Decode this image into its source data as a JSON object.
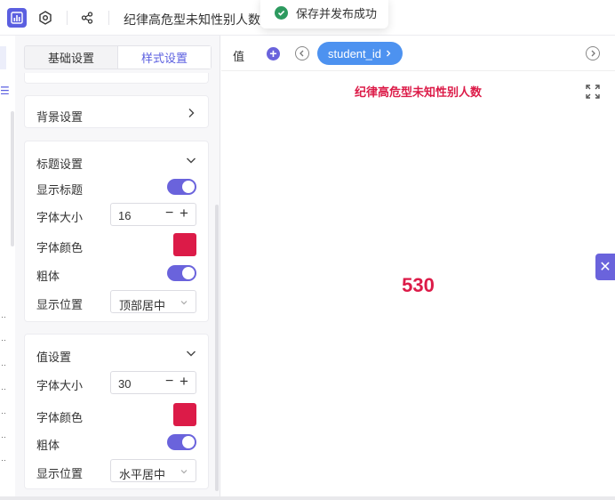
{
  "toolbar": {
    "chart_icon": "bar-chart-icon",
    "settings_icon": "gear-icon",
    "share_icon": "share-icon",
    "title": "纪律高危型未知性别人数"
  },
  "toast": {
    "icon": "check-circle-icon",
    "message": "保存并发布成功"
  },
  "tabs": [
    {
      "label": "基础设置"
    },
    {
      "label": "样式设置"
    }
  ],
  "background_section": {
    "label": "背景设置"
  },
  "title_section": {
    "label": "标题设置",
    "show_title_label": "显示标题",
    "show_title": true,
    "font_size_label": "字体大小",
    "font_size": "16",
    "font_color_label": "字体颜色",
    "font_color": "#dc1b48",
    "bold_label": "粗体",
    "bold": true,
    "position_label": "显示位置",
    "position": "顶部居中"
  },
  "value_section": {
    "label": "值设置",
    "font_size_label": "字体大小",
    "font_size": "30",
    "font_color_label": "字体颜色",
    "font_color": "#dc1b48",
    "bold_label": "粗体",
    "bold": true,
    "position_label": "显示位置",
    "position": "水平居中"
  },
  "preview": {
    "value_label": "值",
    "field_chip": "student_id",
    "chart_title": "纪律高危型未知性别人数",
    "value": "530",
    "accent": "#6a63dc",
    "chip_color": "#4d92f0"
  }
}
